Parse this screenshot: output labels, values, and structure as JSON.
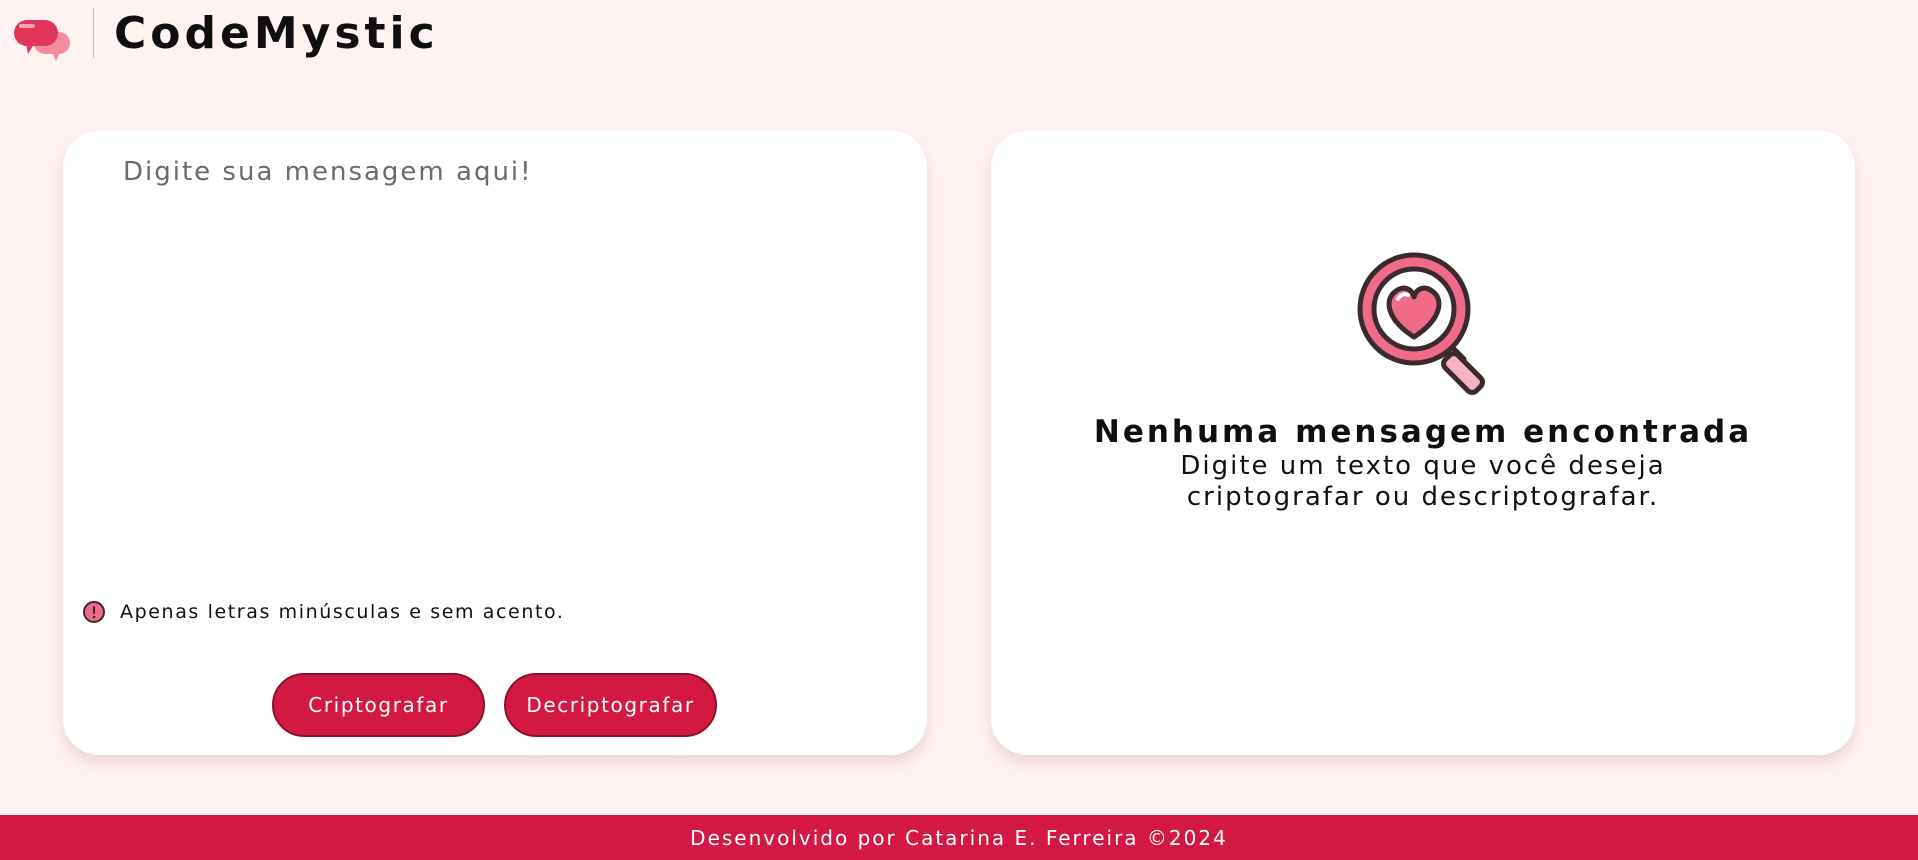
{
  "header": {
    "brand": "CodeMystic",
    "logo_icon": "chat-bubbles-icon"
  },
  "input_panel": {
    "placeholder": "Digite sua mensagem aqui!",
    "hint_icon": "exclamation-circle-icon",
    "hint_text": "Apenas letras minúsculas e sem acento.",
    "encrypt_label": "Criptografar",
    "decrypt_label": "Decriptografar"
  },
  "output_panel": {
    "illustration_icon": "magnifier-heart-icon",
    "title": "Nenhuma mensagem encontrada",
    "description": "Digite um texto que você deseja criptografar ou descriptografar."
  },
  "footer": {
    "text": "Desenvolvido por  Catarina E. Ferreira ©2024"
  },
  "colors": {
    "background": "#fff3f2",
    "accent": "#d31842",
    "accent_border": "#8d0f2e",
    "card": "#ffffff",
    "heart_pink": "#f06b8a"
  }
}
